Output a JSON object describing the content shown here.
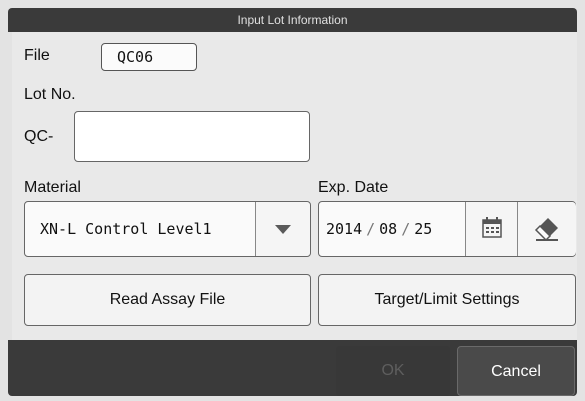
{
  "window": {
    "title": "Input Lot Information"
  },
  "file": {
    "label": "File",
    "value": "QC06"
  },
  "lot": {
    "section_label": "Lot No.",
    "prefix": "QC-",
    "value": ""
  },
  "material": {
    "label": "Material",
    "selected": "XN-L Control Level1",
    "dropdown_icon": "triangle-down-icon"
  },
  "exp_date": {
    "label": "Exp. Date",
    "year": "2014",
    "month": "08",
    "day": "25",
    "separator": "/",
    "calendar_icon": "calendar-icon",
    "clear_icon": "eraser-icon"
  },
  "buttons": {
    "read_assay": "Read Assay File",
    "target_limit": "Target/Limit Settings"
  },
  "footer": {
    "ok": "OK",
    "cancel": "Cancel"
  }
}
